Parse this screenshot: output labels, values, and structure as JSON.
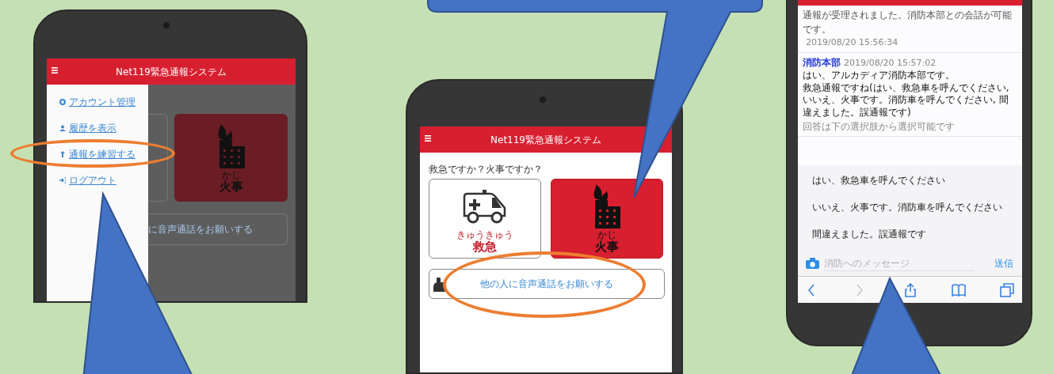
{
  "phone_menu": {
    "header_title": "Net119緊急通報システム",
    "menu_items": [
      {
        "kind": "gear",
        "label": "アカウント管理",
        "highlighted": false
      },
      {
        "kind": "person",
        "label": "履歴を表示",
        "highlighted": false
      },
      {
        "kind": "upload",
        "label": "通報を練習する",
        "highlighted": true
      },
      {
        "kind": "logout",
        "label": "ログアウト",
        "highlighted": false
      }
    ],
    "fire_button": {
      "ruby": "かじ",
      "label": "火事"
    },
    "voice_button": {
      "label": "に音声通話をお願いする"
    }
  },
  "phone_home": {
    "header_title": "Net119緊急通報システム",
    "question": "救急ですか？火事ですか？",
    "buttons": [
      {
        "kind": "ambulance",
        "ruby": "きゅうきゅう",
        "label": "救急"
      },
      {
        "kind": "fire",
        "ruby": "かじ",
        "label": "火事"
      }
    ],
    "voice_button": {
      "label": "他の人に音声通話をお願いする",
      "highlighted": true
    }
  },
  "phone_chat": {
    "messages": [
      {
        "kind": "system",
        "lines": [
          "通報が受理されました。消防本部との会話が可能です。"
        ],
        "time": "2019/08/20 15:56:34"
      },
      {
        "kind": "reply",
        "sender": "消防本部",
        "time": "2019/08/20 15:57:02",
        "lines": [
          "はい、アルカディア消防本部です。",
          "救急通報ですね(はい、救急車を呼んでください, いいえ、火事です。消防車を呼んでください, 間違えました。誤通報です)"
        ],
        "note": "回答は下の選択肢から選択可能です"
      }
    ],
    "choices": [
      "はい、救急車を呼んでください",
      "いいえ、火事です。消防車を呼んでください",
      "間違えました。誤通報です"
    ],
    "input": {
      "placeholder": "消防へのメッセージ"
    },
    "send_button": "送信"
  }
}
